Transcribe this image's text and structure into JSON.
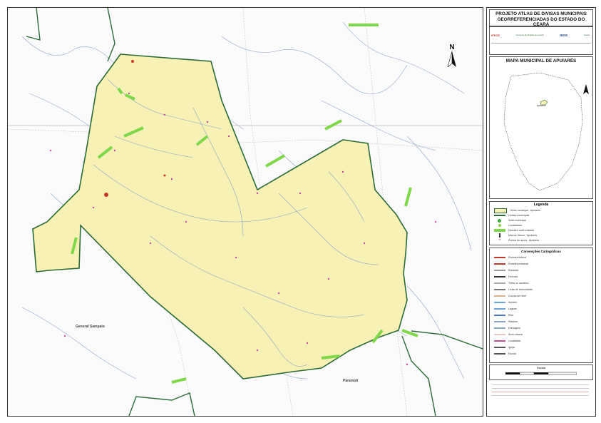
{
  "header": {
    "title_line1": "PROJETO ATLAS DE DIVISAS MUNICIPAIS",
    "title_line2": "GEORREFERENCIADAS DO ESTADO DO CEARÁ",
    "logos": [
      "IPECE",
      "Governo do Estado do Ceará",
      "IBGE",
      "Ceará"
    ]
  },
  "inset": {
    "title": "MAPA MUNICIPAL DE APUIARÉS",
    "highlight": "Apuiarés"
  },
  "legend": {
    "title": "Legenda",
    "items": [
      {
        "label": "Limite municipal - Apuiarés",
        "symbol": "area",
        "color": "#f7f1b5"
      },
      {
        "label": "Limites municipais",
        "symbol": "line",
        "color": "#2b6b36"
      },
      {
        "label": "Sede municipal",
        "symbol": "dot",
        "color": "#3aa83a"
      },
      {
        "label": "Localidades",
        "symbol": "dot",
        "color": "#8ad24a"
      },
      {
        "label": "Divisões confrontantes",
        "symbol": "bar",
        "color": "#7fd84a"
      },
      {
        "label": "Marcos físicos - Apuiarés",
        "symbol": "marker",
        "color": "#333333"
      },
      {
        "label": "Pontos de apoio - Apuiarés",
        "symbol": "cross",
        "color": "#c04fa0"
      }
    ]
  },
  "conventions": {
    "title": "Convenções Cartográficas",
    "items": [
      "Rodovia federal",
      "Rodovia estadual",
      "Estradas",
      "Ferrovia",
      "Trilha ou caminho",
      "Linha de transmissão",
      "Curvas de nível",
      "Açudes",
      "Lagoas",
      "Rios",
      "Riachos",
      "Drenagem",
      "Área urbana",
      "Localidade",
      "Igreja",
      "Escola"
    ]
  },
  "scale": {
    "label": "Escala"
  },
  "map": {
    "north_label": "N",
    "places": [
      {
        "name": "General Sampaio",
        "kind": "b"
      },
      {
        "name": "Paramoti",
        "kind": "b"
      }
    ]
  },
  "colors": {
    "municipality_fill": "#f7f1b5",
    "boundary": "#2b6b36",
    "confrontation_bar": "#7fd84a",
    "drainage": "#8ea5c8",
    "locality": "#c04fa0"
  }
}
